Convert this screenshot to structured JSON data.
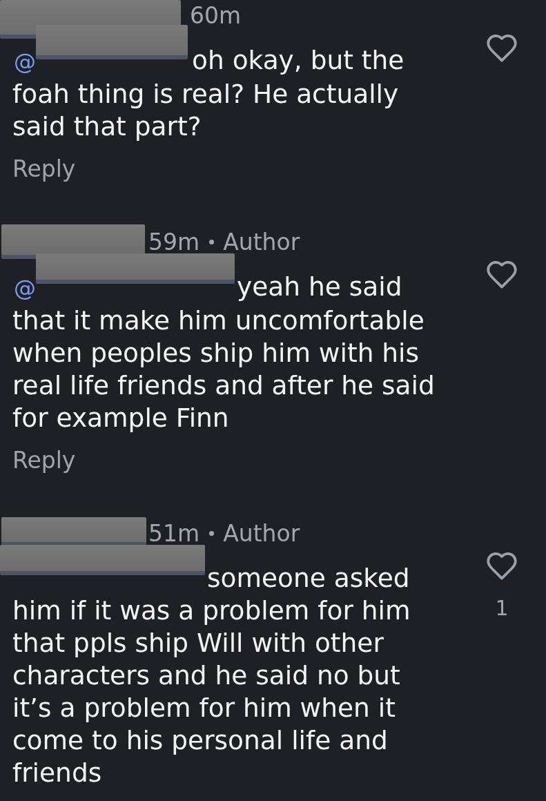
{
  "comments": [
    {
      "time": "60m",
      "mention": "@",
      "text": "oh okay, but the foah thing is real? He actually said that part?",
      "reply": "Reply",
      "liked": false
    },
    {
      "time": "59m",
      "badge": "Author",
      "mention": "@",
      "text": "yeah he said that it make him uncomfortable when peoples ship him with his real life friends and after he said for example Finn",
      "reply": "Reply",
      "liked": false
    },
    {
      "time": "51m",
      "badge": "Author",
      "text": "someone asked him if it was a problem for him that ppls ship Will with other characters and he said no but it’s a problem for him when it come to his personal life and friends",
      "liked": false,
      "like_count": "1"
    }
  ]
}
